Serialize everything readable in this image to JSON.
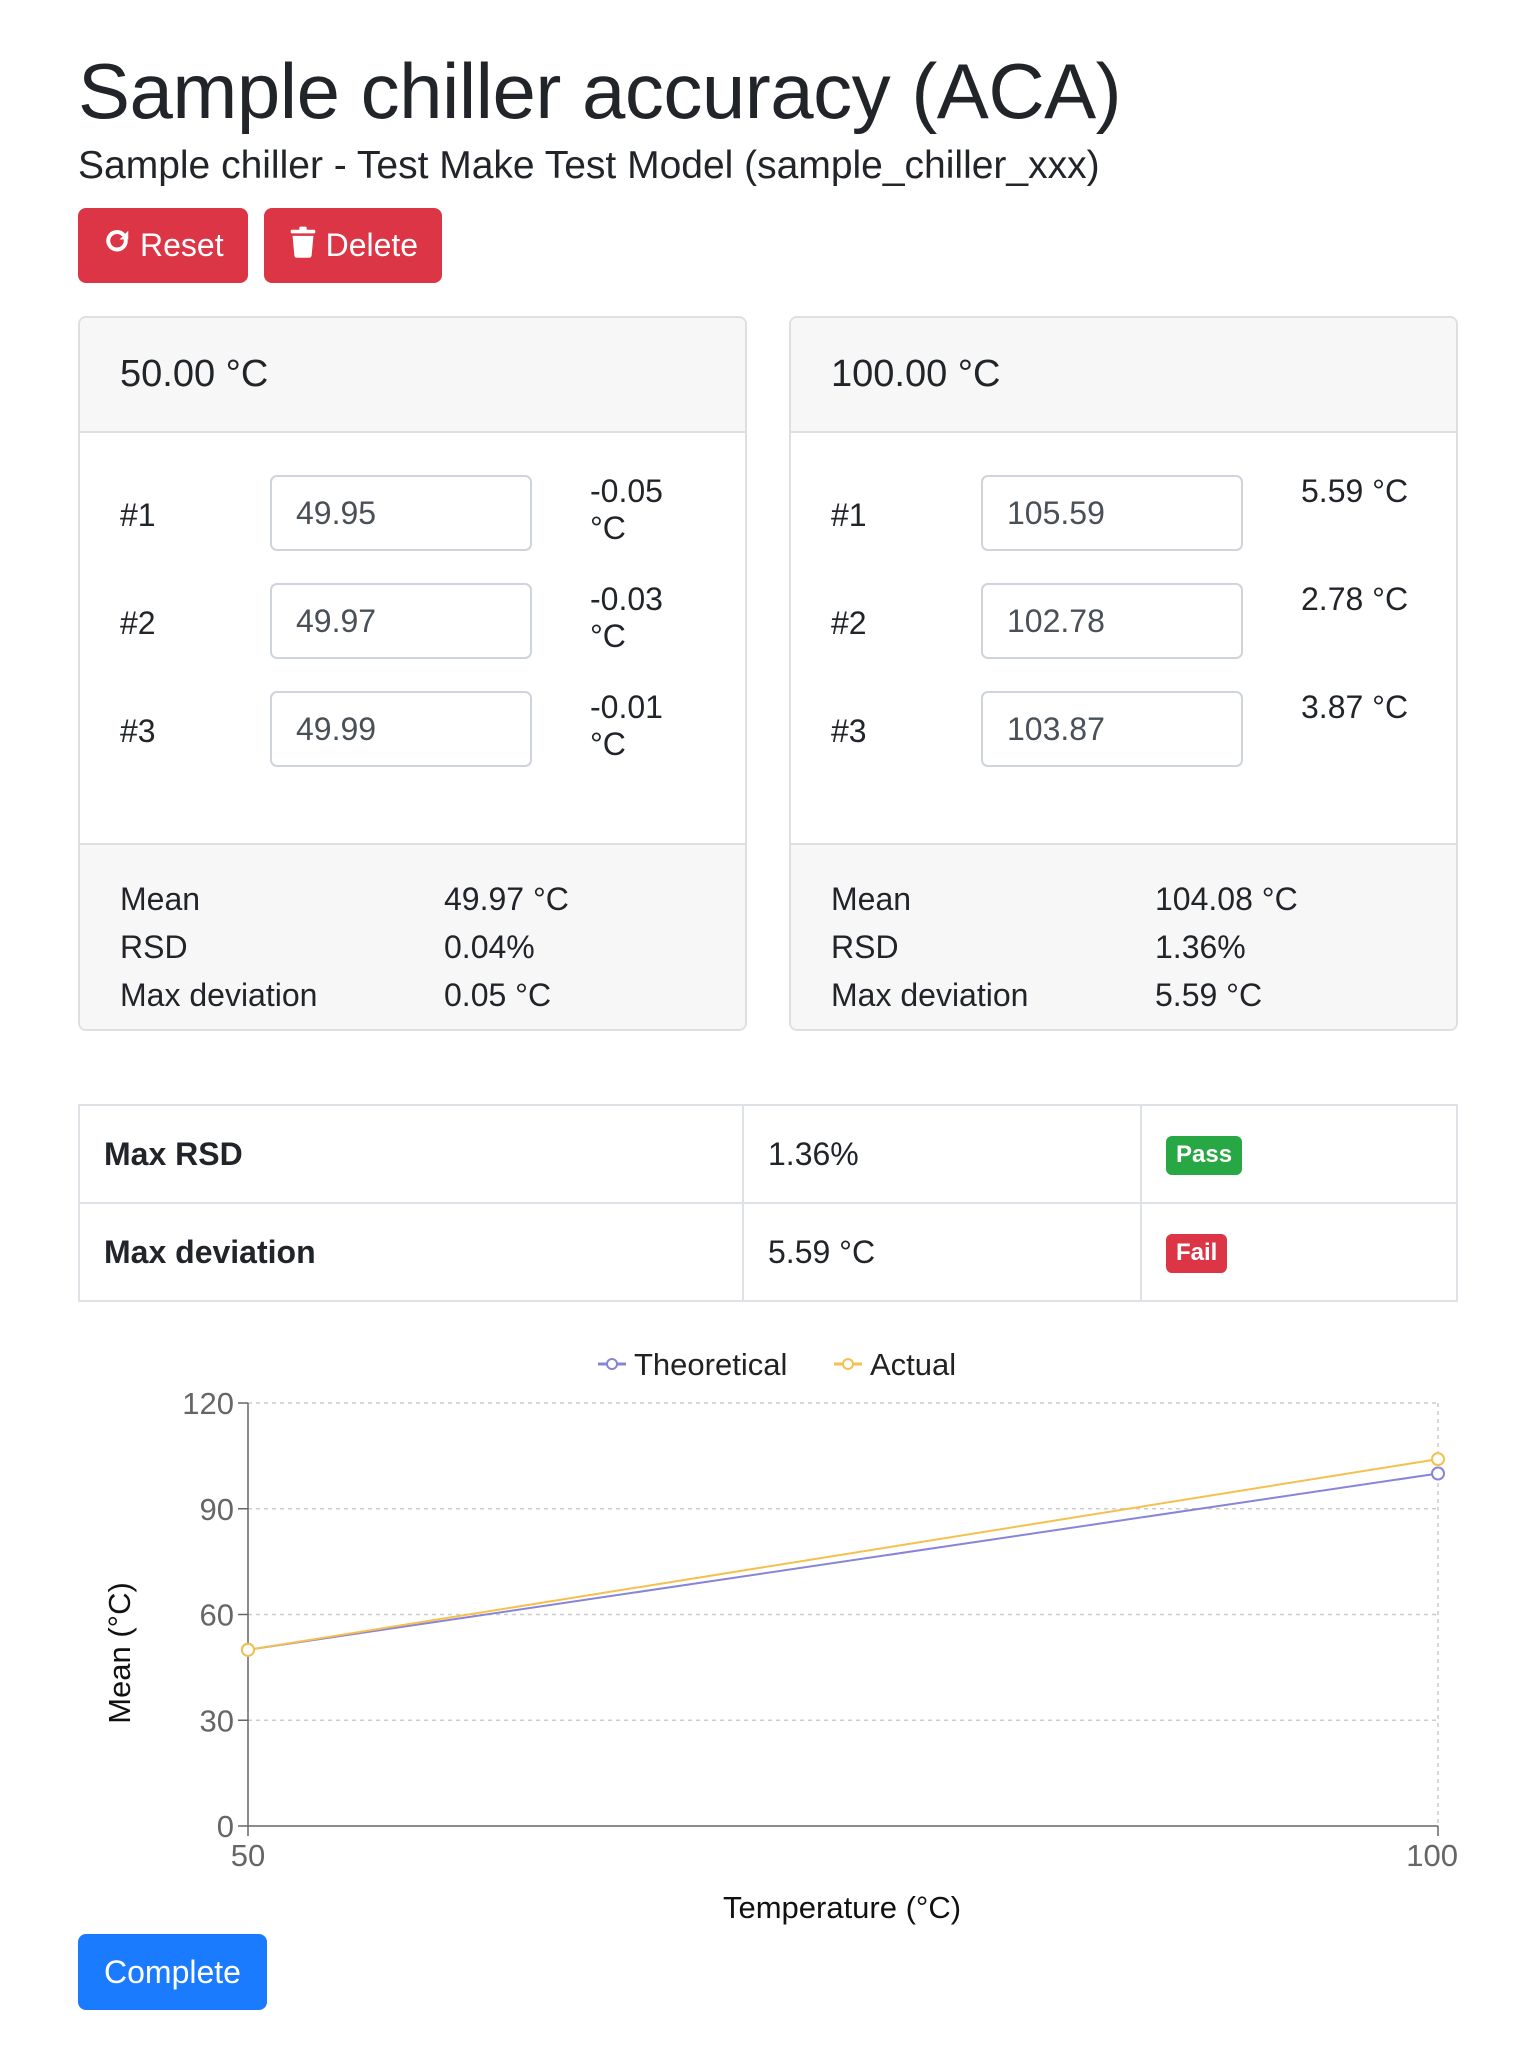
{
  "header": {
    "title": "Sample chiller accuracy (ACA)",
    "subtitle": "Sample chiller - Test Make Test Model (sample_chiller_xxx)"
  },
  "actions": {
    "reset_label": "Reset",
    "delete_label": "Delete",
    "complete_label": "Complete"
  },
  "cards": [
    {
      "setpoint": "50.00 °C",
      "readings": [
        {
          "label": "#1",
          "value": "49.95",
          "deviation": "-0.05 °C"
        },
        {
          "label": "#2",
          "value": "49.97",
          "deviation": "-0.03 °C"
        },
        {
          "label": "#3",
          "value": "49.99",
          "deviation": "-0.01 °C"
        }
      ],
      "stats": [
        {
          "label": "Mean",
          "value": "49.97 °C"
        },
        {
          "label": "RSD",
          "value": "0.04%"
        },
        {
          "label": "Max deviation",
          "value": "0.05 °C"
        }
      ]
    },
    {
      "setpoint": "100.00 °C",
      "readings": [
        {
          "label": "#1",
          "value": "105.59",
          "deviation": "5.59 °C"
        },
        {
          "label": "#2",
          "value": "102.78",
          "deviation": "2.78 °C"
        },
        {
          "label": "#3",
          "value": "103.87",
          "deviation": "3.87 °C"
        }
      ],
      "stats": [
        {
          "label": "Mean",
          "value": "104.08 °C"
        },
        {
          "label": "RSD",
          "value": "1.36%"
        },
        {
          "label": "Max deviation",
          "value": "5.59 °C"
        }
      ]
    }
  ],
  "summary": [
    {
      "metric": "Max RSD",
      "value": "1.36%",
      "result": "Pass"
    },
    {
      "metric": "Max deviation",
      "value": "5.59 °C",
      "result": "Fail"
    }
  ],
  "colors": {
    "danger": "#dc3545",
    "success": "#28a745",
    "primary": "#1a7bff",
    "theoretical": "#8884d8",
    "actual": "#f5c04e"
  },
  "chart_data": {
    "type": "line",
    "title": "",
    "xlabel": "Temperature (°C)",
    "ylabel": "Mean (°C)",
    "x": [
      50,
      100
    ],
    "x_ticks": [
      "50",
      "100"
    ],
    "y_ticks": [
      "0",
      "30",
      "60",
      "90",
      "120"
    ],
    "ylim": [
      0,
      120
    ],
    "grid": true,
    "legend": "top-center",
    "series": [
      {
        "name": "Theoretical",
        "values": [
          50,
          100
        ]
      },
      {
        "name": "Actual",
        "values": [
          49.97,
          104.08
        ]
      }
    ]
  }
}
